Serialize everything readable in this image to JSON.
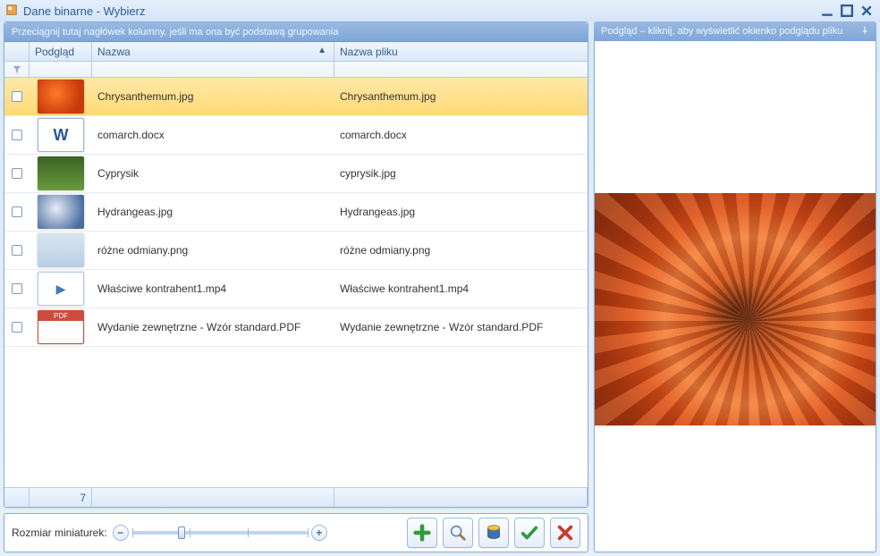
{
  "window": {
    "title": "Dane binarne - Wybierz"
  },
  "groupbar": "Przeciągnij tutaj nagłówek kolumny, jeśli ma ona być podstawą grupowania",
  "columns": {
    "thumb": "Podgląd",
    "name": "Nazwa",
    "file": "Nazwa pliku"
  },
  "rows": [
    {
      "thumb_class": "thumb-chry",
      "name": "Chrysanthemum.jpg",
      "file": "Chrysanthemum.jpg",
      "selected": true
    },
    {
      "thumb_class": "thumb-docx",
      "name": "comarch.docx",
      "file": "comarch.docx",
      "selected": false
    },
    {
      "thumb_class": "thumb-cyprysik",
      "name": "Cyprysik",
      "file": "cyprysik.jpg",
      "selected": false
    },
    {
      "thumb_class": "thumb-hydr",
      "name": "Hydrangeas.jpg",
      "file": "Hydrangeas.jpg",
      "selected": false
    },
    {
      "thumb_class": "thumb-png",
      "name": "różne odmiany.png",
      "file": "różne odmiany.png",
      "selected": false
    },
    {
      "thumb_class": "thumb-mp4",
      "name": "Właściwe kontrahent1.mp4",
      "file": "Właściwe kontrahent1.mp4",
      "selected": false
    },
    {
      "thumb_class": "thumb-pdf",
      "name": "Wydanie zewnętrzne - Wzór standard.PDF",
      "file": "Wydanie zewnętrzne - Wzór standard.PDF",
      "selected": false
    }
  ],
  "footer": {
    "count": "7"
  },
  "toolbar": {
    "size_label": "Rozmiar miniaturek:",
    "slider_pos_pct": 26
  },
  "preview": {
    "header": "Podgląd – kliknij, aby wyświetlić okienko podglądu pliku"
  }
}
